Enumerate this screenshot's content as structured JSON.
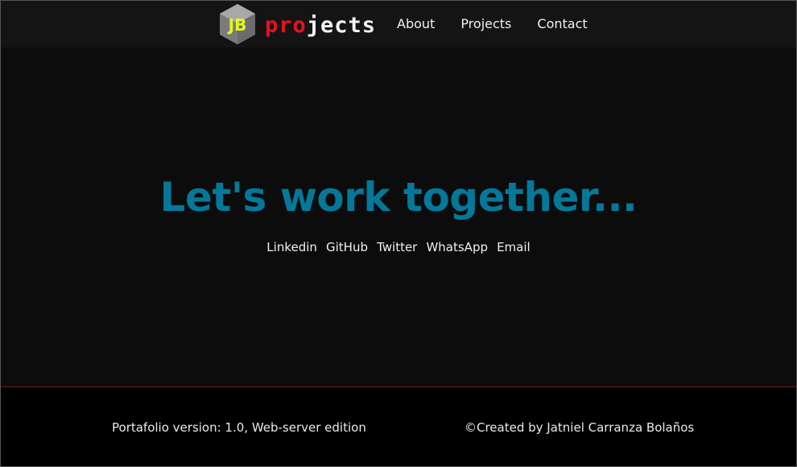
{
  "header": {
    "logo_initials": "JB",
    "wordmark_red": "pro",
    "wordmark_white": "jects",
    "nav": [
      {
        "label": "About"
      },
      {
        "label": "Projects"
      },
      {
        "label": "Contact"
      }
    ]
  },
  "hero": {
    "title": "Let's work together...",
    "links": [
      {
        "label": "Linkedin"
      },
      {
        "label": "GitHub"
      },
      {
        "label": "Twitter"
      },
      {
        "label": "WhatsApp"
      },
      {
        "label": "Email"
      }
    ]
  },
  "footer": {
    "version": "Portafolio version: 1.0, Web-server edition",
    "credit": "©Created by Jatniel Carranza Bolaños"
  },
  "colors": {
    "accent": "#047899",
    "brand_red": "#e8121b",
    "logo_yellow": "#e8f51e",
    "background": "#0c0c0d"
  }
}
